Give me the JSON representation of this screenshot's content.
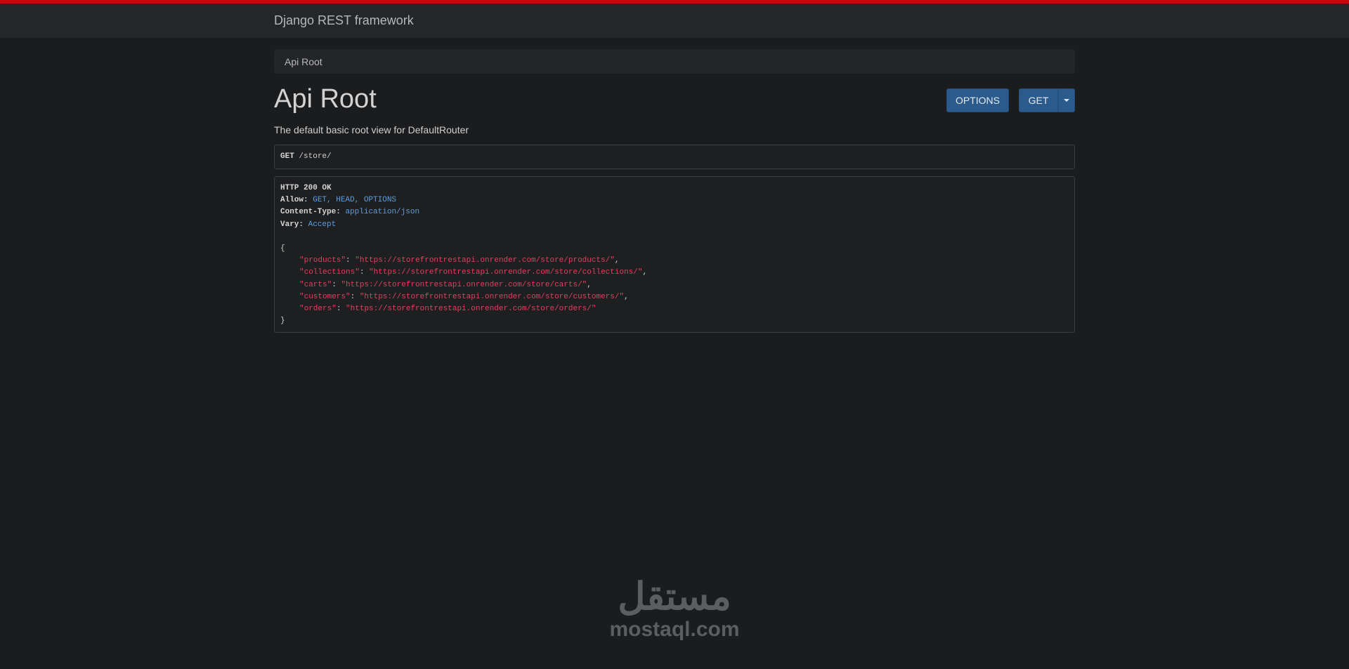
{
  "navbar": {
    "brand": "Django REST framework"
  },
  "breadcrumb": {
    "items": [
      "Api Root"
    ]
  },
  "page": {
    "title": "Api Root",
    "description": "The default basic root view for DefaultRouter"
  },
  "actions": {
    "options_label": "OPTIONS",
    "get_label": "GET",
    "caret_icon": "caret-down-icon"
  },
  "request": {
    "method": "GET",
    "path": "/store/"
  },
  "response": {
    "status": "HTTP 200 OK",
    "headers": [
      {
        "key": "Allow:",
        "value": "GET, HEAD, OPTIONS"
      },
      {
        "key": "Content-Type:",
        "value": "application/json"
      },
      {
        "key": "Vary:",
        "value": "Accept"
      }
    ],
    "open_brace": "{",
    "close_brace": "}",
    "entries": [
      {
        "key": "\"products\"",
        "value": "\"https://storefrontrestapi.onrender.com/store/products/\"",
        "sep": ","
      },
      {
        "key": "\"collections\"",
        "value": "\"https://storefrontrestapi.onrender.com/store/collections/\"",
        "sep": ","
      },
      {
        "key": "\"carts\"",
        "value": "\"https://storefrontrestapi.onrender.com/store/carts/\"",
        "sep": ","
      },
      {
        "key": "\"customers\"",
        "value": "\"https://storefrontrestapi.onrender.com/store/customers/\"",
        "sep": ","
      },
      {
        "key": "\"orders\"",
        "value": "\"https://storefrontrestapi.onrender.com/store/orders/\"",
        "sep": ""
      }
    ]
  },
  "watermark": {
    "arabic": "مستقل",
    "latin": "mostaql.com"
  },
  "colors": {
    "accent_bar": "#c9080c",
    "button": "#2b5b8c",
    "json_string": "#e04060",
    "header_value": "#5e9ee0",
    "background": "#1b1c1e"
  }
}
